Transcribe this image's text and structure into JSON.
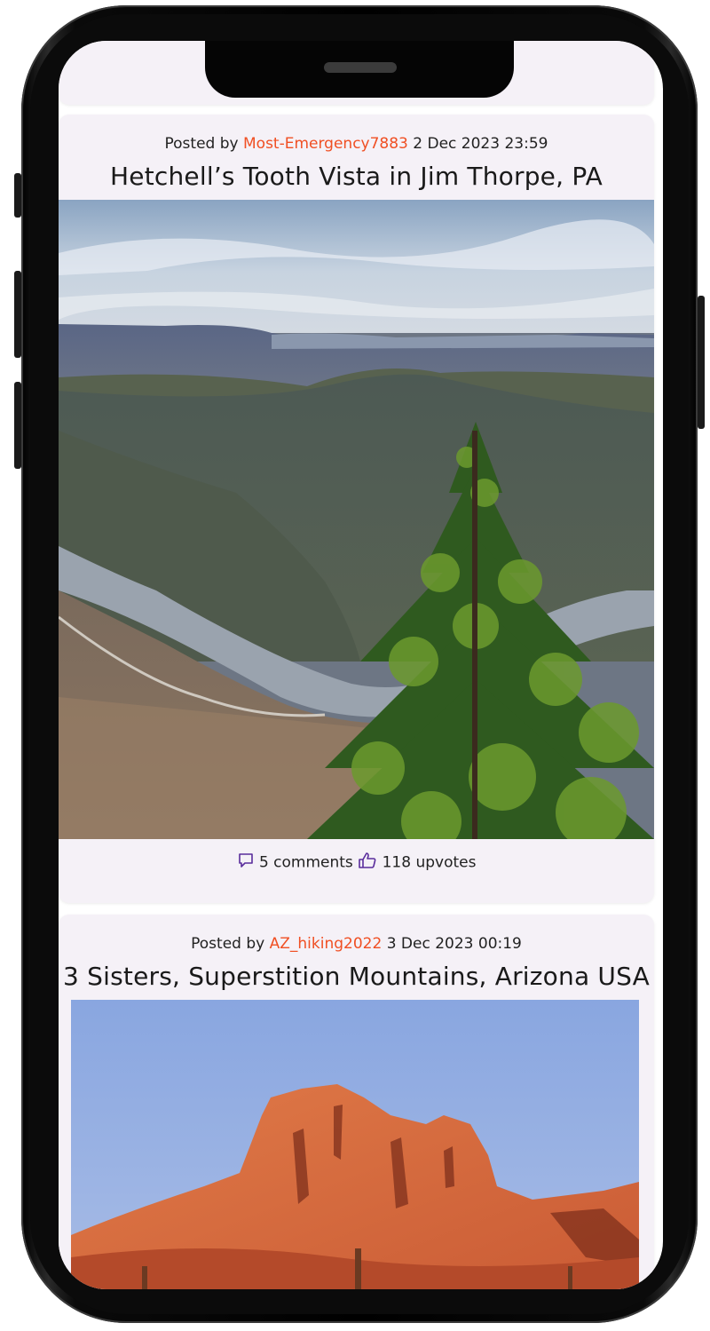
{
  "posts": [
    {
      "posted_by_prefix": "Posted by",
      "author": "Most-Emergency7883",
      "date": "2 Dec 2023 23:59",
      "title": "Hetchell’s Tooth Vista in Jim Thorpe, PA",
      "comments": "5 comments",
      "upvotes": "118 upvotes"
    },
    {
      "posted_by_prefix": "Posted by",
      "author": "AZ_hiking2022",
      "date": "3 Dec 2023 00:19",
      "title": "3 Sisters, Superstition Mountains, Arizona USA"
    }
  ],
  "colors": {
    "author": "#f04f23",
    "icon": "#5a2d9c",
    "card": "#f5f1f7"
  },
  "icons": {
    "comments": "speech-bubble-icon",
    "upvotes": "thumbs-up-icon"
  }
}
